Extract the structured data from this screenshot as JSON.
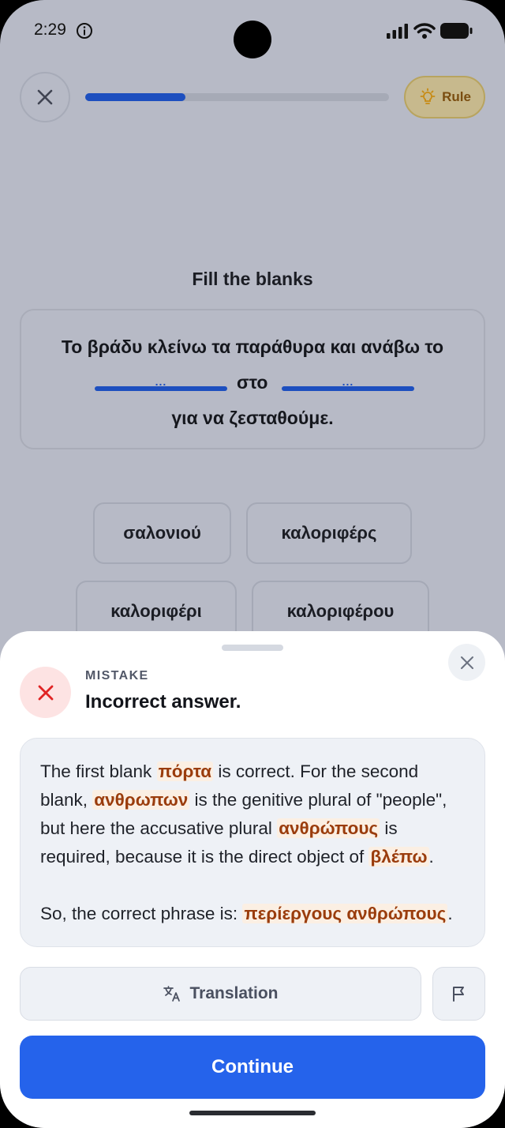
{
  "status_bar": {
    "time": "2:29"
  },
  "top_bar": {
    "progress_fraction": 0.33,
    "rule_label": "Rule"
  },
  "exercise": {
    "prompt": "Fill the blanks",
    "sentence_line1": "Το βράδυ κλείνω τα παράθυρα και ανάβω το",
    "blank_placeholder": "...",
    "middle_word": "στο",
    "sentence_line3": "για να ζεσταθούμε.",
    "options": [
      "σαλονιού",
      "καλοριφέρς",
      "καλοριφέρι",
      "καλοριφέρου"
    ]
  },
  "feedback": {
    "label": "MISTAKE",
    "title": "Incorrect answer.",
    "explanation": {
      "p1_a": "The first blank ",
      "p1_hl1": "πόρτα",
      "p1_b": " is correct. For the second blank, ",
      "p1_hl2": "ανθρωπων",
      "p1_c": " is the genitive plural of \"people\", but here the accusative plural ",
      "p1_hl3": "ανθρώπους",
      "p1_d": " is required, because it is the direct object of ",
      "p1_hl4": "βλέπω",
      "p1_e": ".",
      "p2_a": "So, the correct phrase is: ",
      "p2_hl": "περίεργους ανθρώπους",
      "p2_b": "."
    },
    "translation_label": "Translation",
    "continue_label": "Continue"
  },
  "colors": {
    "accent": "#2563eb",
    "progress": "#1d4fbf",
    "mistake": "#e02424",
    "highlight": "#9a3c0c"
  }
}
